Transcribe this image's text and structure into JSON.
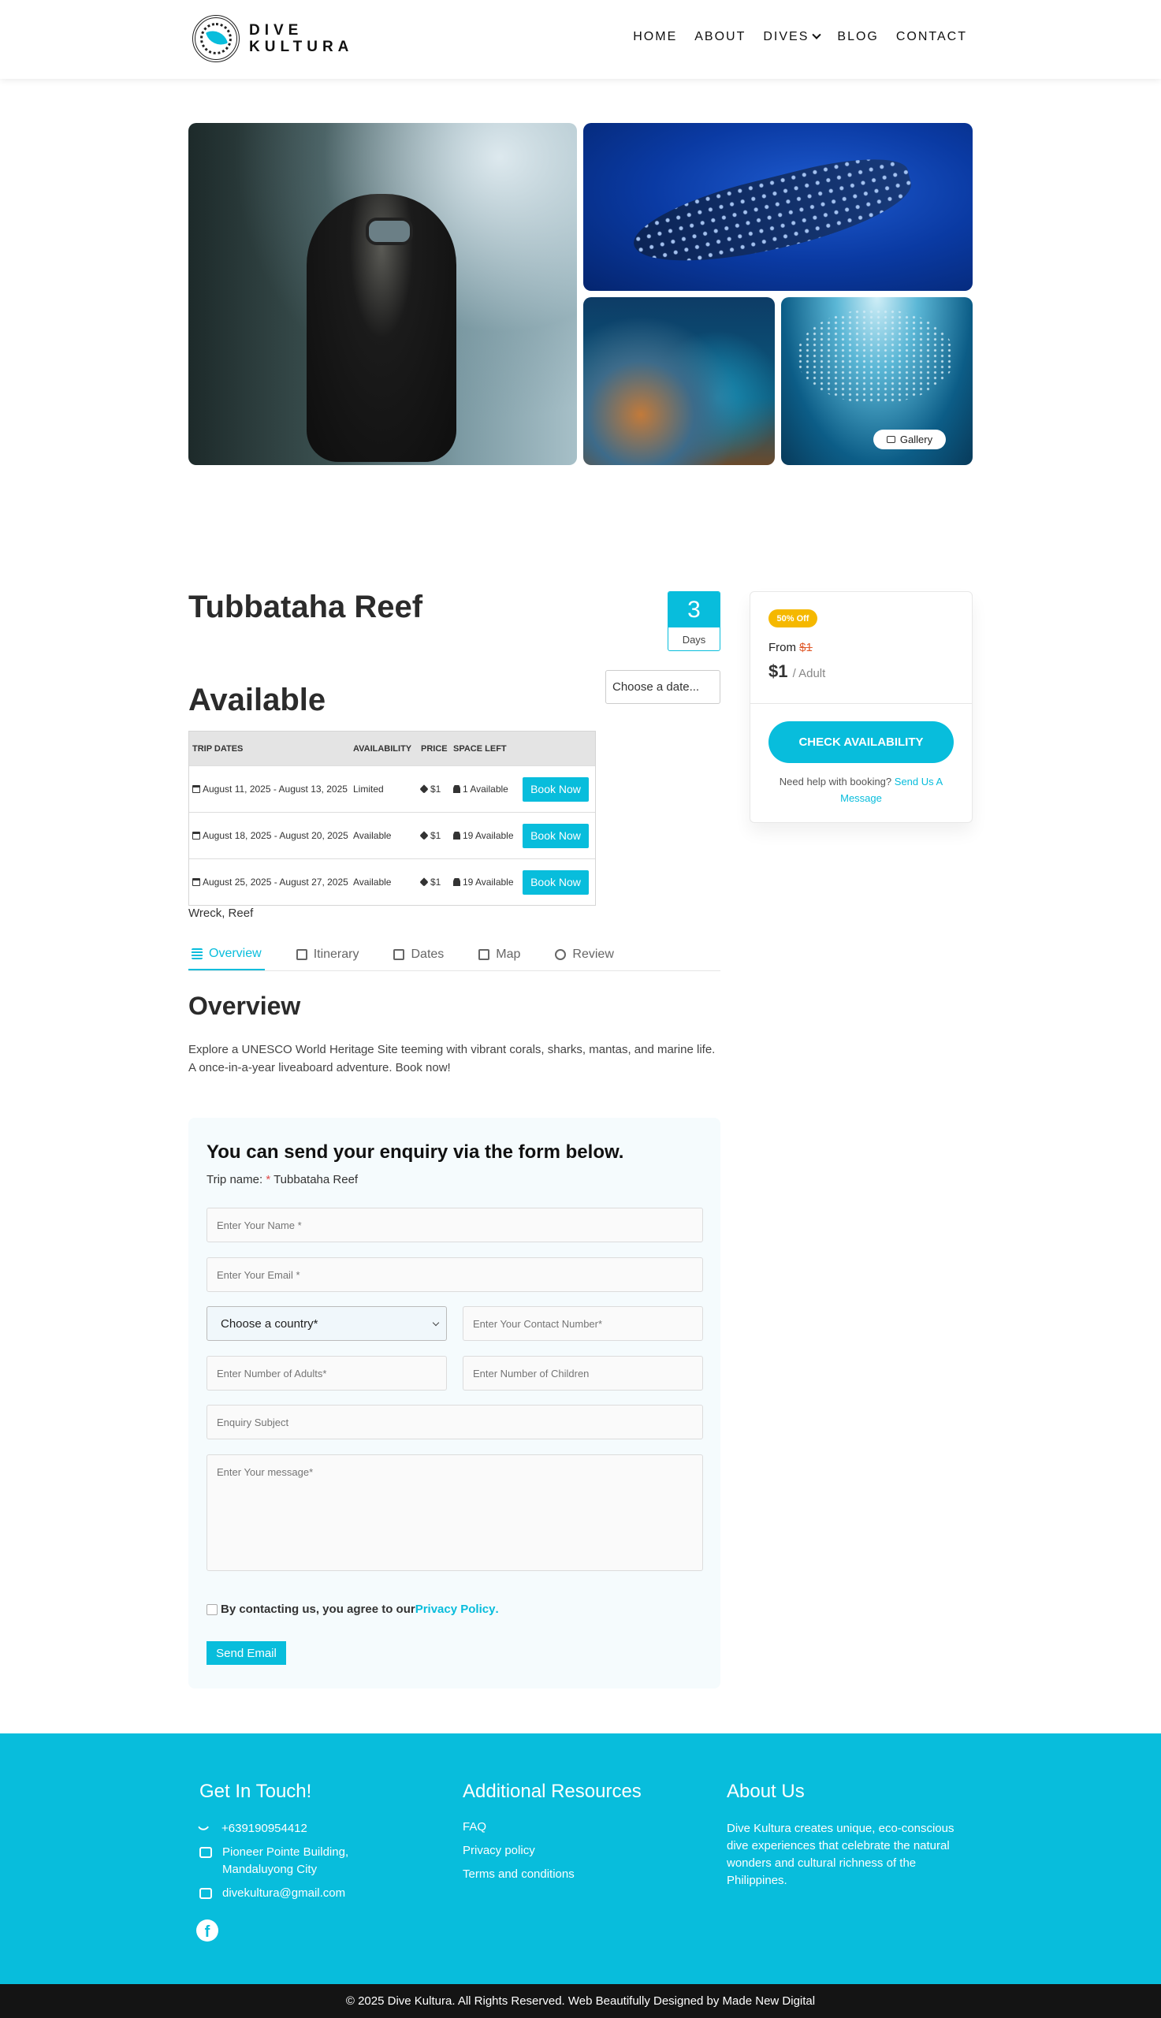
{
  "header": {
    "logo_text_line1": "DIVE",
    "logo_text_line2": "KULTURA",
    "nav": [
      "HOME",
      "ABOUT",
      "DIVES",
      "BLOG",
      "CONTACT"
    ]
  },
  "gallery": {
    "button_label": "Gallery"
  },
  "trip": {
    "title": "Tubbataha Reef",
    "days_value": "3",
    "days_label": "Days",
    "available_heading": "Available",
    "date_placeholder": "Choose a date...",
    "tags": "Wreck, Reef"
  },
  "table": {
    "headers": [
      "TRIP DATES",
      "AVAILABILITY",
      "PRICE",
      "SPACE LEFT"
    ],
    "rows": [
      {
        "dates": "August 11, 2025 - August 13, 2025",
        "availability": "Limited",
        "price": "$1",
        "space": "1 Available",
        "button": "Book Now"
      },
      {
        "dates": "August 18, 2025 - August 20, 2025",
        "availability": "Available",
        "price": "$1",
        "space": "19 Available",
        "button": "Book Now"
      },
      {
        "dates": "August 25, 2025 - August 27, 2025",
        "availability": "Available",
        "price": "$1",
        "space": "19 Available",
        "button": "Book Now"
      }
    ]
  },
  "tabs": [
    "Overview",
    "Itinerary",
    "Dates",
    "Map",
    "Review"
  ],
  "overview": {
    "title": "Overview",
    "text": "Explore a UNESCO World Heritage Site teeming with vibrant corals, sharks, mantas, and marine life. A once-in-a-year liveaboard adventure. Book now!"
  },
  "enquiry": {
    "title": "You can send your enquiry via the form below.",
    "trip_label": "Trip name:",
    "trip_required": "*",
    "trip_value": "Tubbataha Reef",
    "name_placeholder": "Enter Your Name *",
    "email_placeholder": "Enter Your Email *",
    "country_value": "Choose a country*",
    "contact_placeholder": "Enter Your Contact Number*",
    "adults_placeholder": "Enter Number of Adults*",
    "children_placeholder": "Enter Number of Children",
    "subject_placeholder": "Enquiry Subject",
    "message_placeholder": "Enter Your message*",
    "agree_text": "By contacting us, you agree to our",
    "privacy_link": "Privacy Policy",
    "agree_end": ".",
    "send_label": "Send Email"
  },
  "booking": {
    "badge": "50% Off",
    "from_label": "From",
    "old_price": "$1",
    "price": "$1",
    "price_unit": "/ Adult",
    "check_button": "CHECK AVAILABILITY",
    "help_text": "Need help with booking?",
    "help_link": "Send Us A Message"
  },
  "footer": {
    "col1_title": "Get In Touch!",
    "phone": "+639190954412",
    "address": "Pioneer Pointe Building, Mandaluyong City",
    "email": "divekultura@gmail.com",
    "col2_title": "Additional Resources",
    "links": [
      "FAQ",
      "Privacy policy",
      "Terms and conditions"
    ],
    "col3_title": "About Us",
    "about": "Dive Kultura creates unique, eco-conscious dive experiences that celebrate the natural wonders and cultural richness of the Philippines.",
    "copyright": "© 2025 Dive Kultura. All Rights Reserved. Web Beautifully Designed by Made New Digital"
  },
  "colors": {
    "accent": "#08bddc",
    "badge": "#f5b800",
    "footer_bar": "#141414"
  }
}
